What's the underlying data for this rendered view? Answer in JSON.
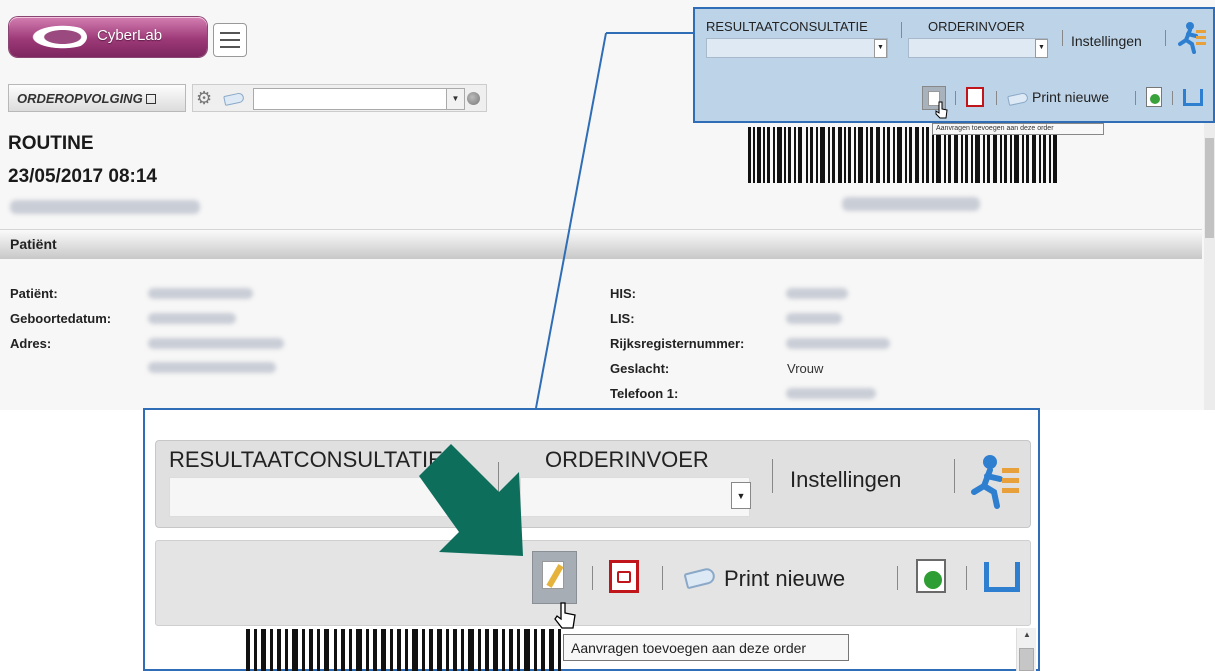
{
  "app": {
    "logo_text": "CyberLab"
  },
  "header": {
    "order_tracking_label": "ORDEROPVOLGING"
  },
  "order": {
    "priority": "ROUTINE",
    "datetime": "23/05/2017 08:14"
  },
  "patient_section": {
    "title": "Patiënt",
    "left_fields": [
      {
        "label": "Patiënt:"
      },
      {
        "label": "Geboortedatum:"
      },
      {
        "label": "Adres:"
      }
    ],
    "right_fields": [
      {
        "label": "HIS:"
      },
      {
        "label": "LIS:"
      },
      {
        "label": "Rijksregisternummer:"
      },
      {
        "label": "Geslacht:",
        "value": "Vrouw"
      },
      {
        "label": "Telefoon 1:"
      }
    ]
  },
  "nav": {
    "results_label": "RESULTAATCONSULTATIE",
    "order_entry_label": "ORDERINVOER",
    "settings_label": "Instellingen"
  },
  "toolbar": {
    "print_new_label": "Print nieuwe"
  },
  "tooltip": {
    "add_requests": "Aanvragen toevoegen aan deze order"
  },
  "colors": {
    "callout_border": "#2f6db6",
    "arrow": "#0e6e5c",
    "logo": "#9d3a78"
  },
  "icons": [
    "list-icon",
    "gear-icon",
    "tag-icon",
    "edit-icon",
    "pdf-icon",
    "add-document-icon",
    "export-icon",
    "running-man-icon"
  ]
}
